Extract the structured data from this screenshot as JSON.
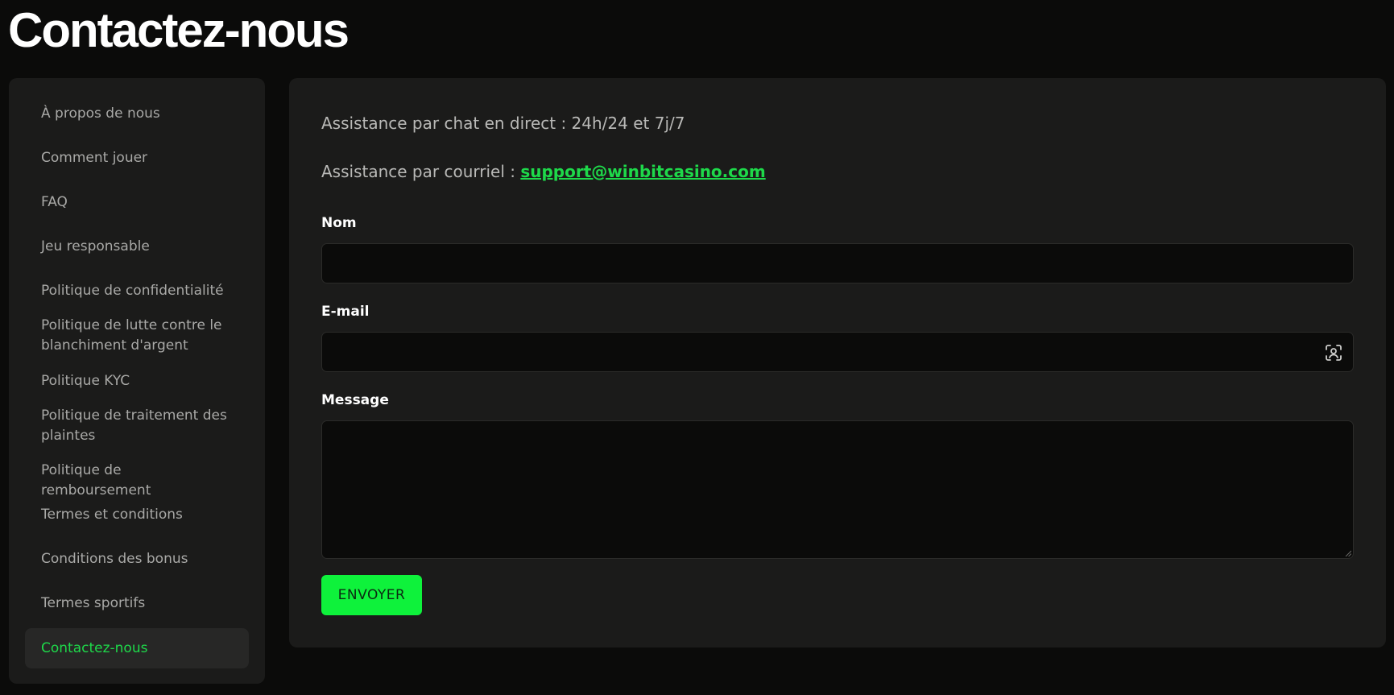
{
  "page": {
    "title": "Contactez-nous"
  },
  "sidebar": {
    "items": [
      {
        "label": "À propos de nous"
      },
      {
        "label": "Comment jouer"
      },
      {
        "label": "FAQ"
      },
      {
        "label": "Jeu responsable"
      },
      {
        "label": "Politique de confidentialité"
      },
      {
        "label": "Politique de lutte contre le blanchiment d'argent"
      },
      {
        "label": "Politique KYC"
      },
      {
        "label": "Politique de traitement des plaintes"
      },
      {
        "label": "Politique de remboursement"
      },
      {
        "label": "Termes et conditions"
      },
      {
        "label": "Conditions des bonus"
      },
      {
        "label": "Termes sportifs"
      },
      {
        "label": "Contactez-nous",
        "active": true
      }
    ]
  },
  "contact": {
    "chat_line": "Assistance par chat en direct : 24h/24 et 7j/7",
    "email_prefix": "Assistance par courriel : ",
    "email_link": "support@winbitcasino.com"
  },
  "form": {
    "name_label": "Nom",
    "name_value": "",
    "email_label": "E-mail",
    "email_value": "",
    "email_icon": "contact-card-icon",
    "message_label": "Message",
    "message_value": "",
    "submit_label": "ENVOYER"
  },
  "colors": {
    "background": "#0b0b0a",
    "panel": "#1b1b1a",
    "accent": "#0ef23b",
    "link": "#1ed94a"
  }
}
